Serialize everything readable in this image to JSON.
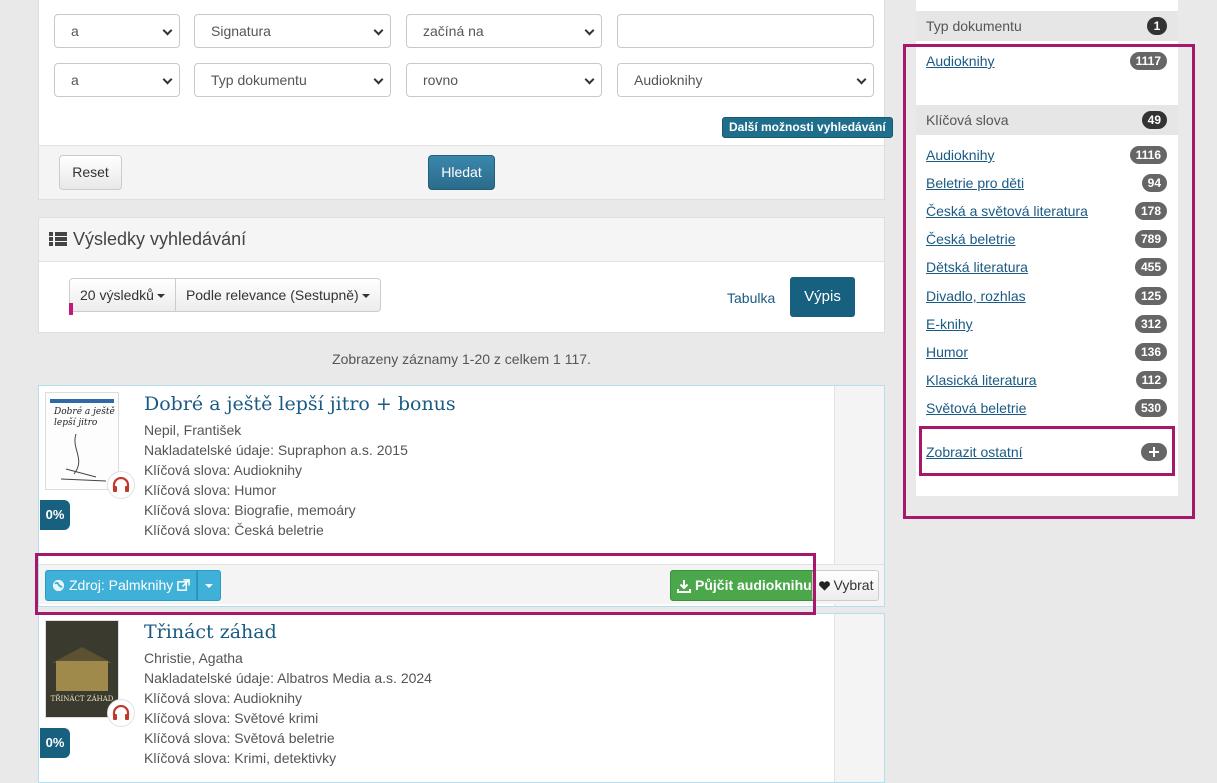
{
  "search": {
    "rows": [
      {
        "operator": "a",
        "field": "Signatura",
        "match": "začíná na",
        "value": ""
      },
      {
        "operator": "a",
        "field": "Typ dokumentu",
        "match": "rovno",
        "value": "Audioknihy"
      }
    ],
    "more_options_label": "Další možnosti vyhledávání",
    "reset_label": "Reset",
    "submit_label": "Hledat"
  },
  "results": {
    "title": "Výsledky vyhledávání",
    "page_size_label": "20 výsledků",
    "sort_label": "Podle relevance (Sestupně)",
    "view_table_label": "Tabulka",
    "view_list_label": "Výpis",
    "count_text": "Zobrazeny záznamy 1-20 z celkem 1 117."
  },
  "records": [
    {
      "title": "Dobré a ještě lepší jitro + bonus",
      "author": "Nepil, František",
      "publisher": "Nakladatelské údaje: Supraphon a.s. 2015",
      "keywords": [
        "Klíčová slova: Audioknihy",
        "Klíčová slova: Humor",
        "Klíčová slova: Biografie, memoáry",
        "Klíčová slova: Česká beletrie"
      ],
      "percent": "0%",
      "cover_text": "Dobré a ještě lepší jitro",
      "source_label": "Zdroj: Palmknihy",
      "borrow_label": "Půjčit audioknihu",
      "select_label": "Vybrat"
    },
    {
      "title": "Třináct záhad",
      "author": "Christie, Agatha",
      "publisher": "Nakladatelské údaje: Albatros Media a.s. 2024",
      "keywords": [
        "Klíčová slova: Audioknihy",
        "Klíčová slova: Světové krimi",
        "Klíčová slova: Světová beletrie",
        "Klíčová slova: Krimi, detektivky"
      ],
      "percent": "0%",
      "cover_text": "TŘINÁCT ZÁHAD"
    }
  ],
  "facets": {
    "doc_type": {
      "title": "Typ dokumentu",
      "count": "1",
      "items": [
        {
          "label": "Audioknihy",
          "count": "1117"
        }
      ]
    },
    "keywords": {
      "title": "Klíčová slova",
      "count": "49",
      "items": [
        {
          "label": "Audioknihy",
          "count": "1116"
        },
        {
          "label": "Beletrie pro děti",
          "count": "94"
        },
        {
          "label": "Česká a světová literatura",
          "count": "178"
        },
        {
          "label": "Česká beletrie",
          "count": "789"
        },
        {
          "label": "Dětská literatura",
          "count": "455"
        },
        {
          "label": "Divadlo, rozhlas",
          "count": "125"
        },
        {
          "label": "E-knihy",
          "count": "312"
        },
        {
          "label": "Humor",
          "count": "136"
        },
        {
          "label": "Klasická literatura",
          "count": "112"
        },
        {
          "label": "Světová beletrie",
          "count": "530"
        }
      ],
      "show_more_label": "Zobrazit ostatní"
    }
  },
  "colors": {
    "accent": "#17607f",
    "highlight": "#a6186b",
    "borrow": "#4aa74a",
    "source": "#3fb0d8"
  }
}
